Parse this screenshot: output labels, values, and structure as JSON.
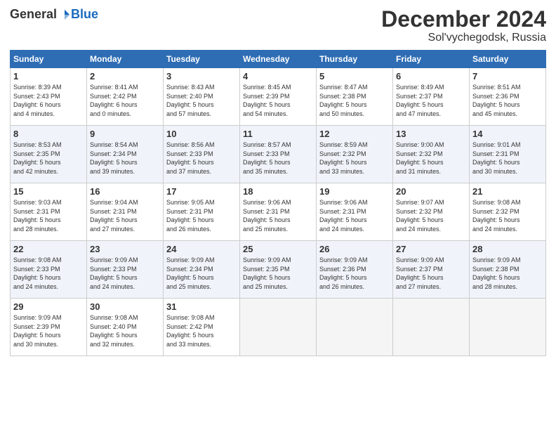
{
  "header": {
    "logo_general": "General",
    "logo_blue": "Blue",
    "title": "December 2024",
    "subtitle": "Sol'vychegodsk, Russia"
  },
  "weekdays": [
    "Sunday",
    "Monday",
    "Tuesday",
    "Wednesday",
    "Thursday",
    "Friday",
    "Saturday"
  ],
  "weeks": [
    [
      {
        "day": "1",
        "info": "Sunrise: 8:39 AM\nSunset: 2:43 PM\nDaylight: 6 hours\nand 4 minutes."
      },
      {
        "day": "2",
        "info": "Sunrise: 8:41 AM\nSunset: 2:42 PM\nDaylight: 6 hours\nand 0 minutes."
      },
      {
        "day": "3",
        "info": "Sunrise: 8:43 AM\nSunset: 2:40 PM\nDaylight: 5 hours\nand 57 minutes."
      },
      {
        "day": "4",
        "info": "Sunrise: 8:45 AM\nSunset: 2:39 PM\nDaylight: 5 hours\nand 54 minutes."
      },
      {
        "day": "5",
        "info": "Sunrise: 8:47 AM\nSunset: 2:38 PM\nDaylight: 5 hours\nand 50 minutes."
      },
      {
        "day": "6",
        "info": "Sunrise: 8:49 AM\nSunset: 2:37 PM\nDaylight: 5 hours\nand 47 minutes."
      },
      {
        "day": "7",
        "info": "Sunrise: 8:51 AM\nSunset: 2:36 PM\nDaylight: 5 hours\nand 45 minutes."
      }
    ],
    [
      {
        "day": "8",
        "info": "Sunrise: 8:53 AM\nSunset: 2:35 PM\nDaylight: 5 hours\nand 42 minutes."
      },
      {
        "day": "9",
        "info": "Sunrise: 8:54 AM\nSunset: 2:34 PM\nDaylight: 5 hours\nand 39 minutes."
      },
      {
        "day": "10",
        "info": "Sunrise: 8:56 AM\nSunset: 2:33 PM\nDaylight: 5 hours\nand 37 minutes."
      },
      {
        "day": "11",
        "info": "Sunrise: 8:57 AM\nSunset: 2:33 PM\nDaylight: 5 hours\nand 35 minutes."
      },
      {
        "day": "12",
        "info": "Sunrise: 8:59 AM\nSunset: 2:32 PM\nDaylight: 5 hours\nand 33 minutes."
      },
      {
        "day": "13",
        "info": "Sunrise: 9:00 AM\nSunset: 2:32 PM\nDaylight: 5 hours\nand 31 minutes."
      },
      {
        "day": "14",
        "info": "Sunrise: 9:01 AM\nSunset: 2:31 PM\nDaylight: 5 hours\nand 30 minutes."
      }
    ],
    [
      {
        "day": "15",
        "info": "Sunrise: 9:03 AM\nSunset: 2:31 PM\nDaylight: 5 hours\nand 28 minutes."
      },
      {
        "day": "16",
        "info": "Sunrise: 9:04 AM\nSunset: 2:31 PM\nDaylight: 5 hours\nand 27 minutes."
      },
      {
        "day": "17",
        "info": "Sunrise: 9:05 AM\nSunset: 2:31 PM\nDaylight: 5 hours\nand 26 minutes."
      },
      {
        "day": "18",
        "info": "Sunrise: 9:06 AM\nSunset: 2:31 PM\nDaylight: 5 hours\nand 25 minutes."
      },
      {
        "day": "19",
        "info": "Sunrise: 9:06 AM\nSunset: 2:31 PM\nDaylight: 5 hours\nand 24 minutes."
      },
      {
        "day": "20",
        "info": "Sunrise: 9:07 AM\nSunset: 2:32 PM\nDaylight: 5 hours\nand 24 minutes."
      },
      {
        "day": "21",
        "info": "Sunrise: 9:08 AM\nSunset: 2:32 PM\nDaylight: 5 hours\nand 24 minutes."
      }
    ],
    [
      {
        "day": "22",
        "info": "Sunrise: 9:08 AM\nSunset: 2:33 PM\nDaylight: 5 hours\nand 24 minutes."
      },
      {
        "day": "23",
        "info": "Sunrise: 9:09 AM\nSunset: 2:33 PM\nDaylight: 5 hours\nand 24 minutes."
      },
      {
        "day": "24",
        "info": "Sunrise: 9:09 AM\nSunset: 2:34 PM\nDaylight: 5 hours\nand 25 minutes."
      },
      {
        "day": "25",
        "info": "Sunrise: 9:09 AM\nSunset: 2:35 PM\nDaylight: 5 hours\nand 25 minutes."
      },
      {
        "day": "26",
        "info": "Sunrise: 9:09 AM\nSunset: 2:36 PM\nDaylight: 5 hours\nand 26 minutes."
      },
      {
        "day": "27",
        "info": "Sunrise: 9:09 AM\nSunset: 2:37 PM\nDaylight: 5 hours\nand 27 minutes."
      },
      {
        "day": "28",
        "info": "Sunrise: 9:09 AM\nSunset: 2:38 PM\nDaylight: 5 hours\nand 28 minutes."
      }
    ],
    [
      {
        "day": "29",
        "info": "Sunrise: 9:09 AM\nSunset: 2:39 PM\nDaylight: 5 hours\nand 30 minutes."
      },
      {
        "day": "30",
        "info": "Sunrise: 9:08 AM\nSunset: 2:40 PM\nDaylight: 5 hours\nand 32 minutes."
      },
      {
        "day": "31",
        "info": "Sunrise: 9:08 AM\nSunset: 2:42 PM\nDaylight: 5 hours\nand 33 minutes."
      },
      {
        "day": "",
        "info": ""
      },
      {
        "day": "",
        "info": ""
      },
      {
        "day": "",
        "info": ""
      },
      {
        "day": "",
        "info": ""
      }
    ]
  ]
}
